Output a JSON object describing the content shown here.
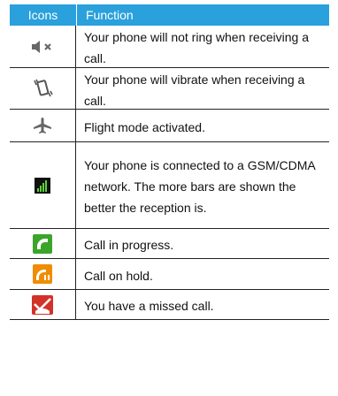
{
  "header": {
    "icons": "Icons",
    "function": "Function"
  },
  "rows": [
    {
      "icon": "silent-mode-icon",
      "text": "Your phone will not ring when receiving a call."
    },
    {
      "icon": "vibrate-mode-icon",
      "text": "Your phone will vibrate when receiving a call."
    },
    {
      "icon": "airplane-icon",
      "text": "Flight mode activated."
    },
    {
      "icon": "signal-bars-icon",
      "text": "Your phone is connected to a GSM/CDMA network. The more bars are shown the better the reception is."
    },
    {
      "icon": "call-in-progress-icon",
      "text": "Call in progress."
    },
    {
      "icon": "call-on-hold-icon",
      "text": "Call on hold."
    },
    {
      "icon": "missed-call-icon",
      "text": "You have a missed call."
    }
  ],
  "colors": {
    "header_bg": "#2aa0dc",
    "call_green": "#3aa52a",
    "hold_orange": "#f08c00",
    "missed_red": "#d23228"
  }
}
